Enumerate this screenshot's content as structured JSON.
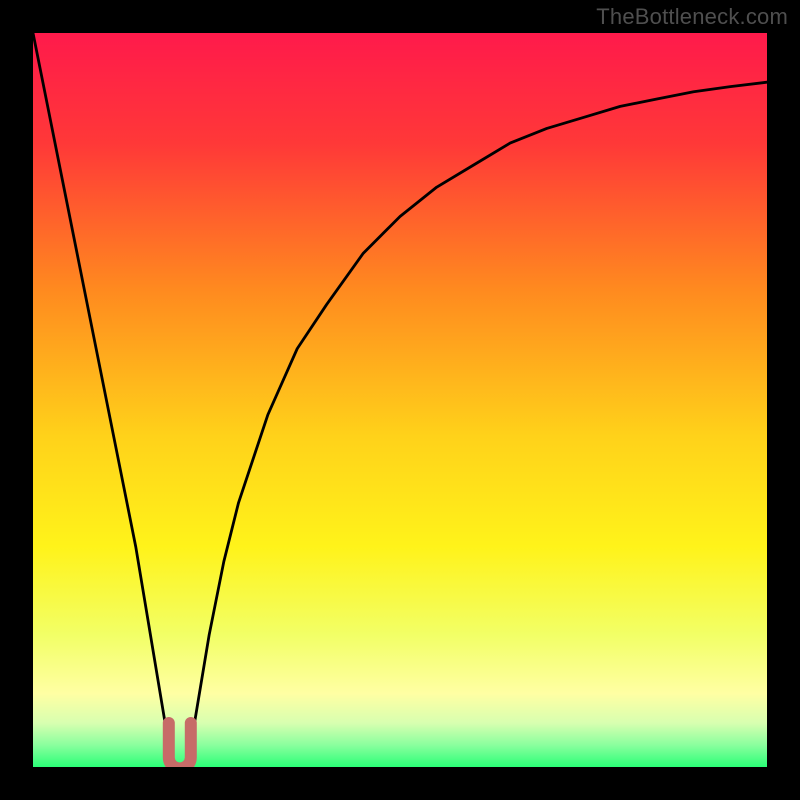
{
  "watermark": "TheBottleneck.com",
  "chart_data": {
    "type": "line",
    "title": "",
    "xlabel": "",
    "ylabel": "",
    "xlim": [
      0,
      100
    ],
    "ylim": [
      0,
      100
    ],
    "grid": false,
    "legend": false,
    "background": {
      "type": "vertical-gradient",
      "stops": [
        {
          "pos": 0.0,
          "color": "#ff1a4b"
        },
        {
          "pos": 0.15,
          "color": "#ff3838"
        },
        {
          "pos": 0.35,
          "color": "#ff8a1f"
        },
        {
          "pos": 0.55,
          "color": "#ffd21a"
        },
        {
          "pos": 0.7,
          "color": "#fff31a"
        },
        {
          "pos": 0.82,
          "color": "#f2ff66"
        },
        {
          "pos": 0.9,
          "color": "#ffffa3"
        },
        {
          "pos": 0.94,
          "color": "#d8ffb0"
        },
        {
          "pos": 0.97,
          "color": "#8aff9e"
        },
        {
          "pos": 1.0,
          "color": "#2bff77"
        }
      ]
    },
    "series": [
      {
        "name": "bottleneck-curve",
        "color": "#000000",
        "x": [
          0,
          2,
          4,
          6,
          8,
          10,
          12,
          14,
          16,
          18,
          18.5,
          19,
          19.5,
          20.5,
          21,
          21.5,
          22,
          24,
          26,
          28,
          32,
          36,
          40,
          45,
          50,
          55,
          60,
          65,
          70,
          75,
          80,
          85,
          90,
          95,
          100
        ],
        "values": [
          100,
          90,
          80,
          70,
          60,
          50,
          40,
          30,
          18,
          6,
          3,
          1,
          0,
          0,
          1,
          3,
          6,
          18,
          28,
          36,
          48,
          57,
          63,
          70,
          75,
          79,
          82,
          85,
          87,
          88.5,
          90,
          91,
          92,
          92.7,
          93.3
        ]
      }
    ],
    "markers": [
      {
        "name": "minimum-dip-marker",
        "shape": "u",
        "x": 20,
        "y": 1,
        "width_x": 3,
        "height_y": 5,
        "stroke": "#c76b68",
        "stroke_width": 10
      }
    ]
  }
}
